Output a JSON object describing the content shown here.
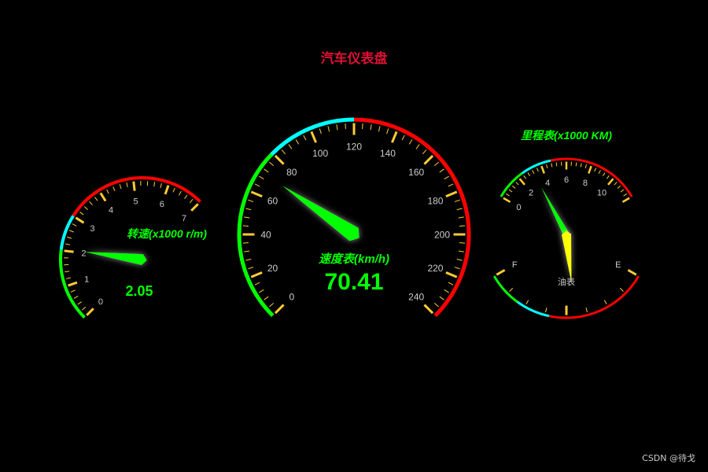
{
  "title": "汽车仪表盘",
  "watermark": "CSDN @待戈",
  "colors": {
    "background": "#000000",
    "title": "#dd1133",
    "green": "#00ff00",
    "cyan": "#00ffff",
    "red": "#ff0000",
    "tick": "#ffcc33",
    "label": "#cccccc",
    "fuel_pointer": "#ffff00"
  },
  "chart_data": [
    {
      "type": "gauge",
      "name": "速度表(km/h)",
      "value": 70.41,
      "value_text": "70.41",
      "min": 0,
      "max": 240,
      "split_number": 12,
      "tick_labels": [
        "0",
        "20",
        "40",
        "60",
        "80",
        "100",
        "120",
        "140",
        "160",
        "180",
        "200",
        "220",
        "240"
      ],
      "axis_color_bands": [
        [
          0.33,
          "#00ff00"
        ],
        [
          0.5,
          "#00ffff"
        ],
        [
          1,
          "#ff0000"
        ]
      ]
    },
    {
      "type": "gauge",
      "name": "转速(x1000 r/m)",
      "value": 2.05,
      "value_text": "2.05",
      "min": 0,
      "max": 7,
      "split_number": 7,
      "tick_labels": [
        "0",
        "1",
        "2",
        "3",
        "4",
        "5",
        "6",
        "7"
      ],
      "axis_color_bands": [
        [
          0.29,
          "#00ff00"
        ],
        [
          0.43,
          "#00ffff"
        ],
        [
          1,
          "#ff0000"
        ]
      ]
    },
    {
      "type": "gauge",
      "name": "里程表(x1000 KM)",
      "value": 3.2,
      "min": 0,
      "max": 12,
      "split_number": 6,
      "tick_labels": [
        "0",
        "2",
        "4",
        "6",
        "8",
        "10"
      ],
      "axis_color_bands": [
        [
          0.2,
          "#00ff00"
        ],
        [
          0.4,
          "#00ffff"
        ],
        [
          1,
          "#ff0000"
        ]
      ]
    },
    {
      "type": "gauge",
      "name": "油表",
      "value": 0.55,
      "min": 0,
      "max": 1,
      "split_number": 2,
      "tick_labels": [
        "E",
        "F"
      ],
      "axis_color_bands": [
        [
          0.2,
          "#00ff00"
        ],
        [
          0.4,
          "#00ffff"
        ],
        [
          1,
          "#ff0000"
        ]
      ]
    }
  ]
}
